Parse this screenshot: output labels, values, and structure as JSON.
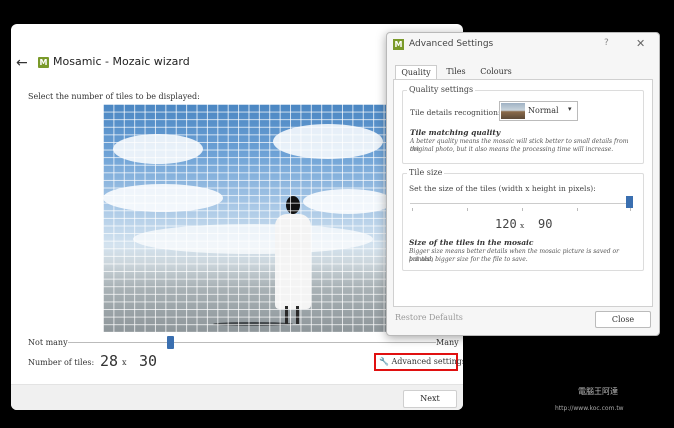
{
  "wizard": {
    "back_glyph": "←",
    "logo_letter": "M",
    "title": "Mosamic - Mozaic wizard",
    "prompt": "Select the number of tiles to be displayed:",
    "slider_min_label": "Not many",
    "slider_max_label": "Many",
    "tiles_label": "Number of tiles:",
    "tiles_x": "28",
    "tiles_sep": "x",
    "tiles_y": "30",
    "advanced_icon": "wrench-icon",
    "advanced_label": "Advanced settings",
    "next_label": "Next"
  },
  "dialog": {
    "logo_letter": "M",
    "title": "Advanced Settings",
    "help_glyph": "?",
    "close_glyph": "✕",
    "tabs": [
      "Quality",
      "Tiles",
      "Colours"
    ],
    "active_tab": "Quality",
    "quality_group": "Quality settings",
    "recognition_label": "Tile details recognition:",
    "recognition_value": "Normal",
    "matching_heading": "Tile matching quality",
    "matching_text_1": "A better quality means the mosaic will stick better to small details from the",
    "matching_text_2": "original photo, but it also means the processing time will increase.",
    "size_group": "Tile size",
    "size_label": "Set the size of the tiles (width x height in pixels):",
    "tile_w": "120",
    "tile_sep": "x",
    "tile_h": "90",
    "size_heading": "Size of the tiles in the mosaic",
    "size_text_1": "Bigger size means better details when the mosaic picture is saved or printed,",
    "size_text_2": "but also bigger size for the file to save.",
    "restore_label": "Restore Defaults",
    "close_label": "Close"
  },
  "watermark": {
    "line1": "電腦王阿達",
    "line2": "http://www.koc.com.tw"
  }
}
